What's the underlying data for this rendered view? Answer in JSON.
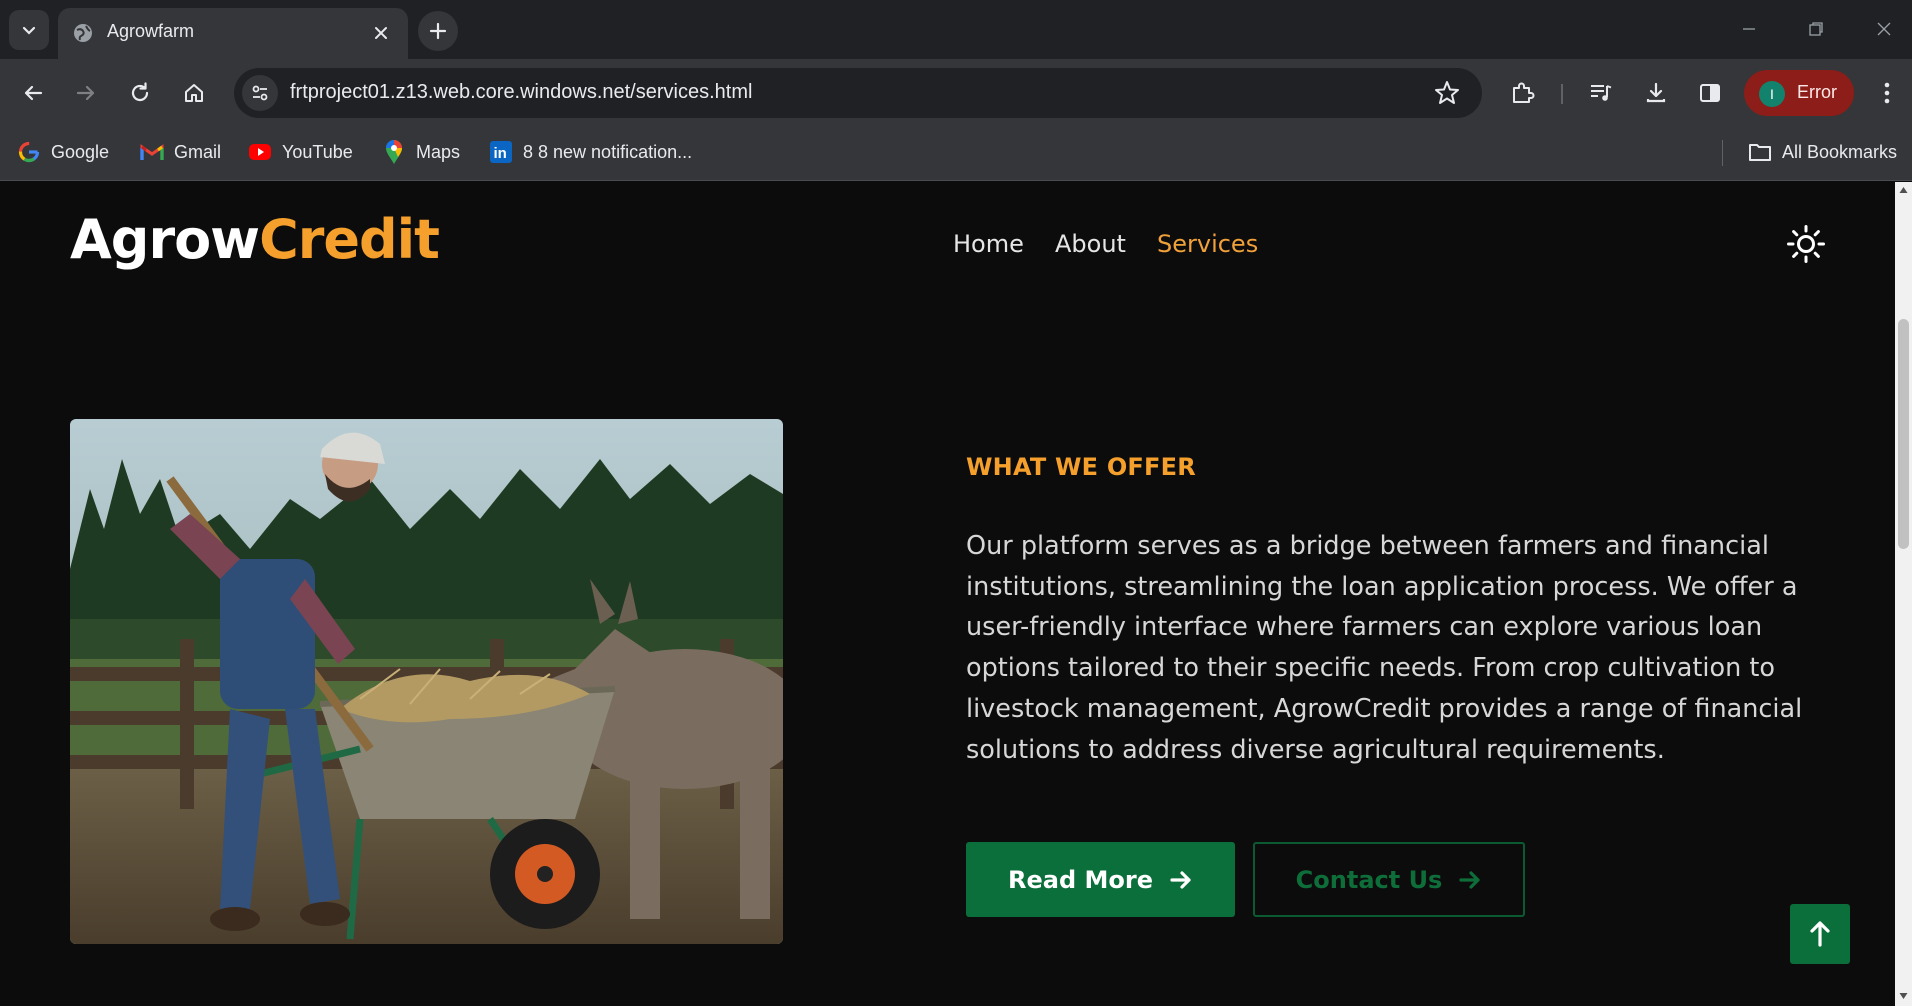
{
  "browser": {
    "tab_title": "Agrowfarm",
    "url": "frtproject01.z13.web.core.windows.net/services.html",
    "profile_initial": "I",
    "profile_label": "Error",
    "bookmarks": [
      {
        "label": "Google",
        "icon": "google-icon"
      },
      {
        "label": "Gmail",
        "icon": "gmail-icon"
      },
      {
        "label": "YouTube",
        "icon": "youtube-icon"
      },
      {
        "label": "Maps",
        "icon": "maps-icon"
      },
      {
        "label": "8 8 new notification...",
        "icon": "linkedin-icon"
      }
    ],
    "all_bookmarks": "All Bookmarks"
  },
  "site": {
    "logo_part1": "Agrow",
    "logo_part2": "Credit",
    "nav": [
      "Home",
      "About",
      "Services"
    ],
    "active_nav": "Services",
    "colors": {
      "accent": "#f5a02c",
      "green": "#0a6f3a",
      "background": "#0c0c0c"
    }
  },
  "section": {
    "eyebrow": "WHAT WE OFFER",
    "description": "Our platform serves as a bridge between farmers and financial institutions, streamlining the loan application process. We offer a user-friendly interface where farmers can explore various loan options tailored to their specific needs. From crop cultivation to livestock management, AgrowCredit provides a range of financial solutions to address diverse agricultural requirements.",
    "read_more": "Read More",
    "contact_us": "Contact Us"
  }
}
